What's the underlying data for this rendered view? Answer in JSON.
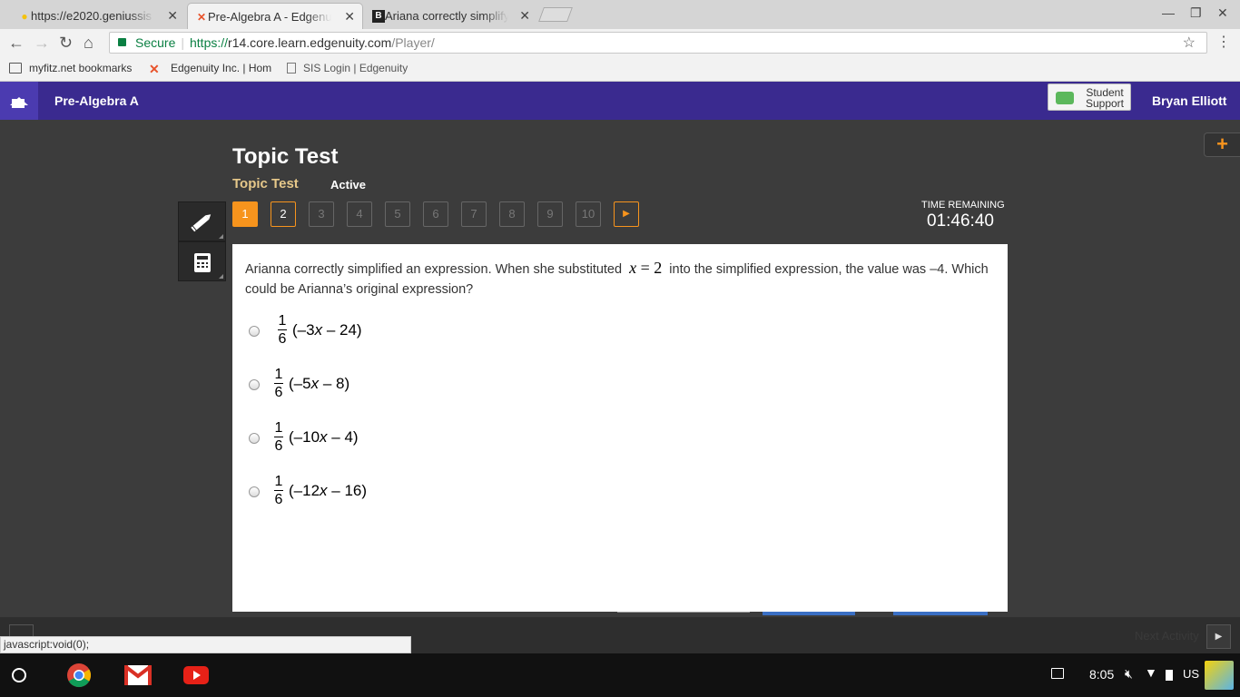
{
  "browser": {
    "tabs": [
      {
        "title": "https://e2020.geniussis",
        "favicon": "bulb-icon"
      },
      {
        "title": "Pre-Algebra A - Edgenuity",
        "favicon": "edgenuity-x-icon",
        "active": true
      },
      {
        "title": "Ariana correctly simplify",
        "favicon": "brainly-b-icon"
      }
    ],
    "secure_label": "Secure",
    "url_scheme": "https://",
    "url_host": "r14.core.learn.edgenuity.com",
    "url_path": "/Player/",
    "bookmarks": [
      "myfitz.net bookmarks",
      "Edgenuity Inc. | Hom",
      "SIS Login | Edgenuity"
    ]
  },
  "app": {
    "course_title": "Pre-Algebra A",
    "support_line1": "Student",
    "support_line2": "Support",
    "user_name": "Bryan Elliott"
  },
  "test": {
    "title": "Topic Test",
    "subtitle": "Topic Test",
    "status": "Active",
    "question_numbers": [
      "1",
      "2",
      "3",
      "4",
      "5",
      "6",
      "7",
      "8",
      "9",
      "10"
    ],
    "current_question": 1,
    "time_label": "TIME REMAINING",
    "time_value": "01:46:40"
  },
  "question": {
    "text_before": "Arianna correctly simplified an expression. When she substituted",
    "math_var": "x",
    "math_eq": " = 2",
    "text_after": "into the simplified expression, the value was –4.  Which could be Arianna’s original expression?",
    "options": [
      {
        "num": "1",
        "den": "6",
        "open": "(–3",
        "var": "x",
        "close": "– 24)"
      },
      {
        "num": "1",
        "den": "6",
        "open": "(–5",
        "var": "x",
        "close": "– 8)"
      },
      {
        "num": "1",
        "den": "6",
        "open": "(–10",
        "var": "x",
        "close": "– 4)"
      },
      {
        "num": "1",
        "den": "6",
        "open": "(–12",
        "var": "x",
        "close": "– 16)"
      }
    ]
  },
  "footer": {
    "next_activity": "Next Activity",
    "status_url": "javascript:void(0);"
  },
  "system_tray": {
    "time": "8:05",
    "locale": "US"
  },
  "colors": {
    "header_purple": "#3a2a8f",
    "accent_orange": "#f7941d",
    "background_dark": "#3c3c3c"
  }
}
